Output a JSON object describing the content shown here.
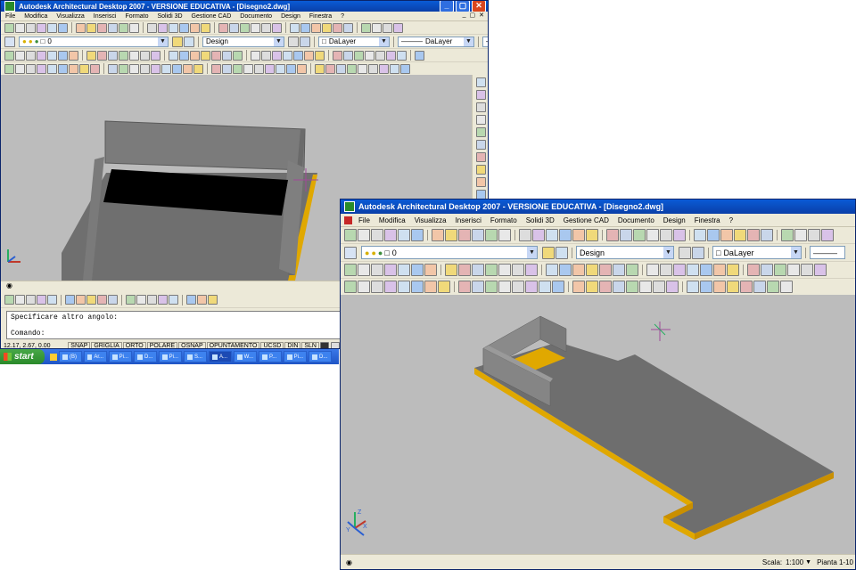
{
  "back_window": {
    "title": "Autodesk Architectural Desktop 2007 - VERSIONE EDUCATIVA - [Disegno2.dwg]",
    "window_buttons": [
      "_",
      "▢",
      "✕"
    ],
    "doc_buttons": [
      "_",
      "▢",
      "✕"
    ],
    "menu": [
      "File",
      "Modifica",
      "Visualizza",
      "Inserisci",
      "Formato",
      "Solidi 3D",
      "Gestione CAD",
      "Documento",
      "Design",
      "Finestra",
      "?"
    ],
    "layer_value": "0",
    "style_value": "Design",
    "color_value": "DaLayer",
    "linetype_value": "DaLayer",
    "lineweight_value": "Da",
    "command_lines": [
      "Specificare altro angolo:",
      "",
      "Comando:"
    ],
    "coords": "12.17, 2.67, 0.00",
    "status_buttons": [
      "SNAP",
      "GRIGLIA",
      "ORTO",
      "POLARE",
      "OSNAP",
      "OPUNTAMENTO",
      "UCSD",
      "DIN",
      "SLN"
    ]
  },
  "taskbar": {
    "start_label": "start",
    "items": [
      "(B)",
      "Ar...",
      "Pi...",
      "D...",
      "Pi...",
      "S...",
      "A...",
      "W...",
      "P...",
      "Pi...",
      "D..."
    ],
    "active_index": 6
  },
  "front_window": {
    "title": "Autodesk Architectural Desktop 2007 - VERSIONE EDUCATIVA - [Disegno2.dwg]",
    "menu": [
      "File",
      "Modifica",
      "Visualizza",
      "Inserisci",
      "Formato",
      "Solidi 3D",
      "Gestione CAD",
      "Documento",
      "Design",
      "Finestra",
      "?"
    ],
    "layer_value": "0",
    "style_value": "Design",
    "color_value": "DaLayer",
    "scale_label": "Scala:",
    "scale_value": "1:100",
    "plan_label": "Pianta 1-10"
  },
  "ucs": {
    "x": "X",
    "y": "Y",
    "z": "Z"
  },
  "colors": {
    "viewport": "#bcbcbc",
    "slab_top": "#6e6e6e",
    "slab_edge": "#e0a800",
    "wall": "#7a7a7a",
    "opening": "#000000",
    "title_blue": "#0a5bd6"
  }
}
